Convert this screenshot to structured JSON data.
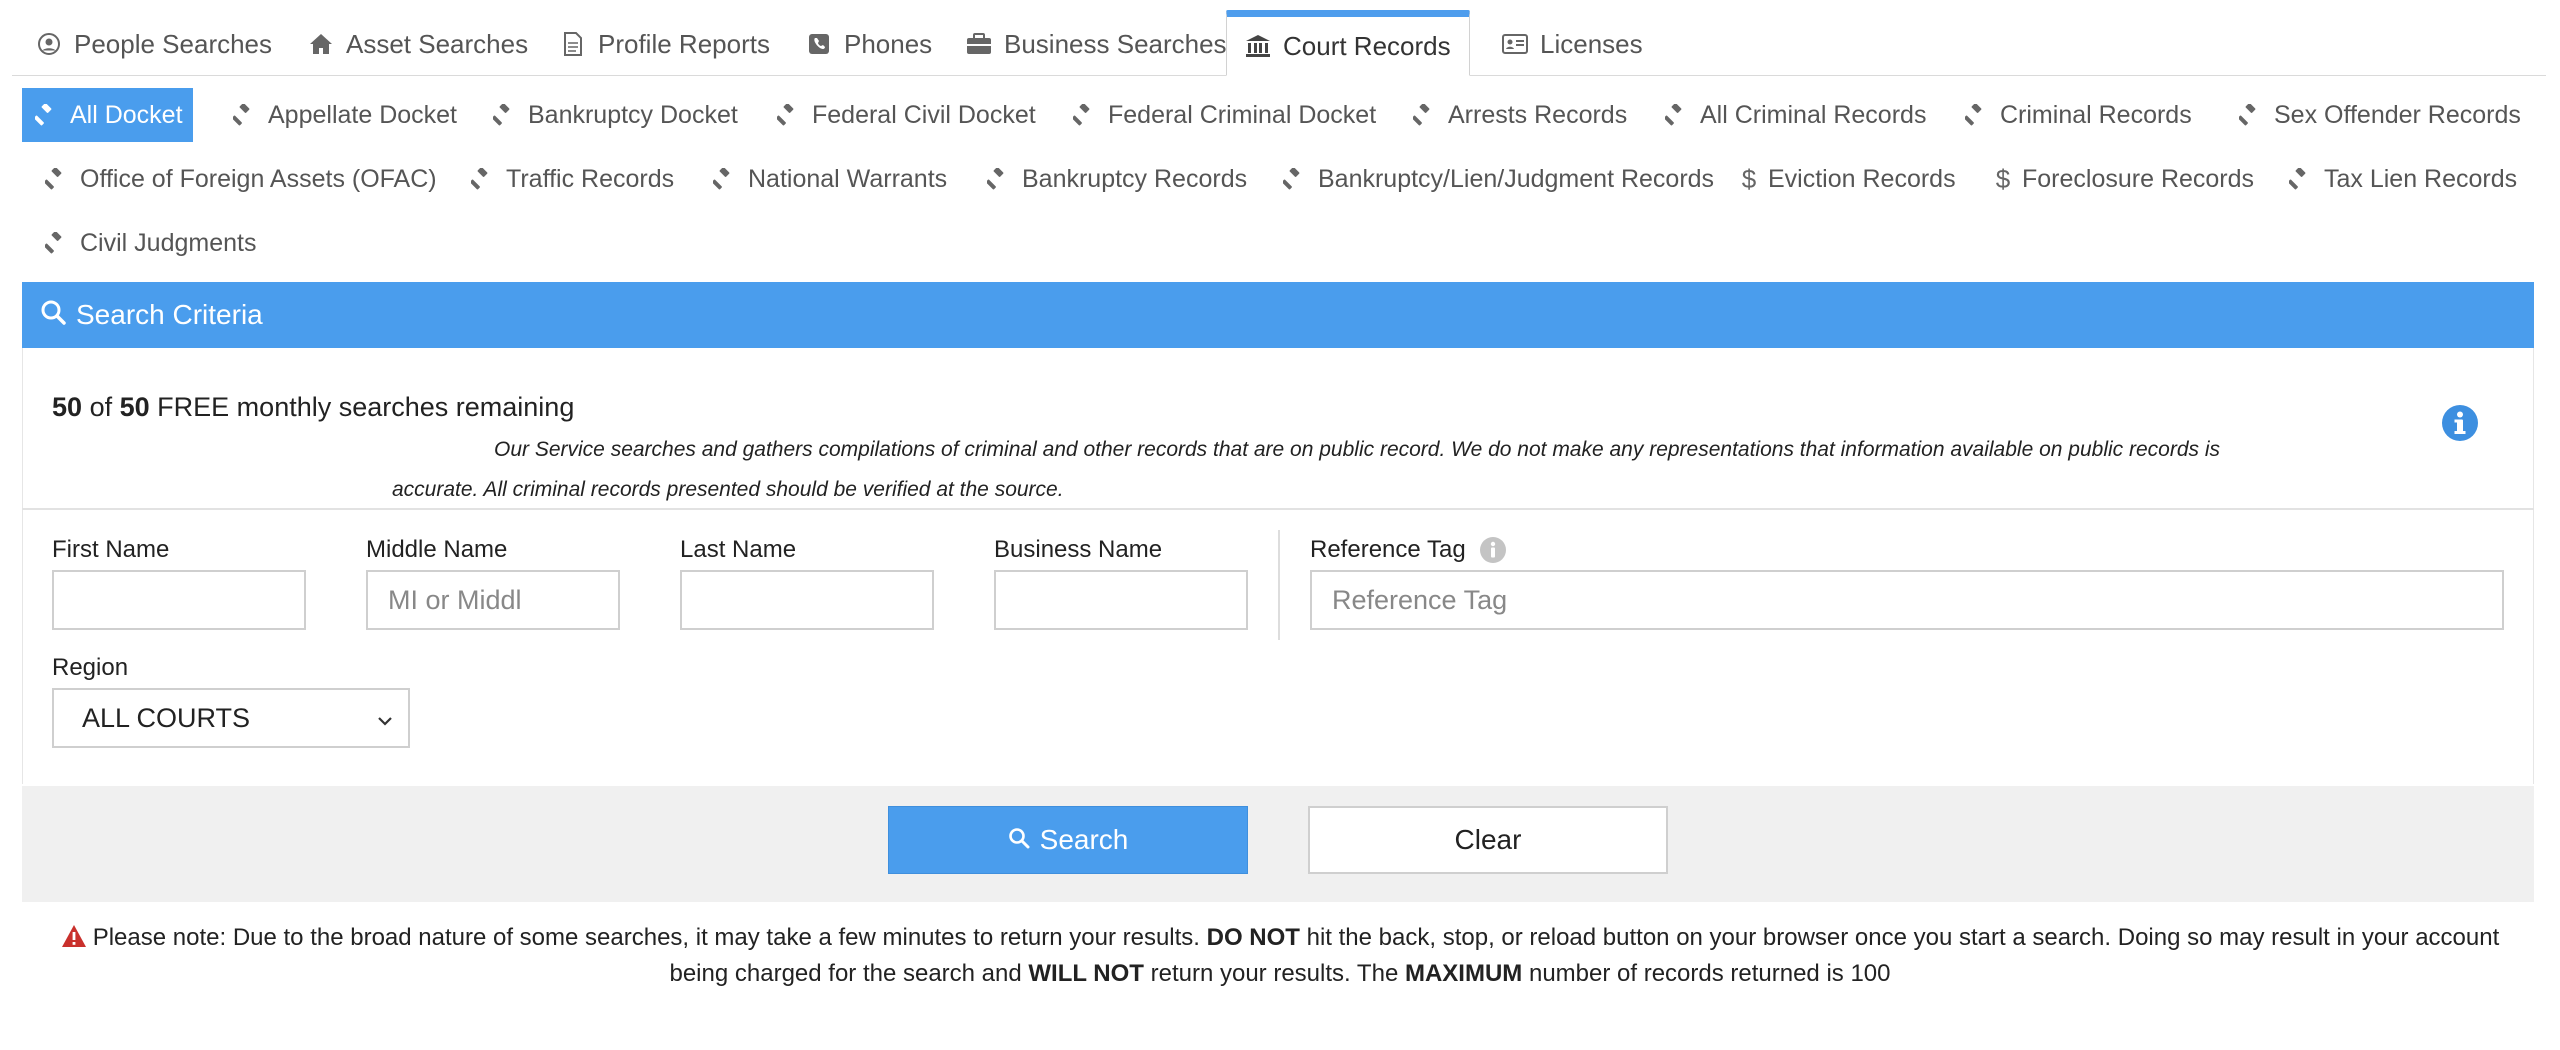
{
  "top_tabs": [
    {
      "label": "People Searches",
      "icon": "user-circle-icon"
    },
    {
      "label": "Asset Searches",
      "icon": "home-icon"
    },
    {
      "label": "Profile Reports",
      "icon": "document-icon"
    },
    {
      "label": "Phones",
      "icon": "phone-icon"
    },
    {
      "label": "Business Searches",
      "icon": "briefcase-icon"
    },
    {
      "label": "Court Records",
      "icon": "courthouse-icon",
      "active": true
    },
    {
      "label": "Licenses",
      "icon": "id-card-icon"
    }
  ],
  "sub_tabs": [
    {
      "label": "All Docket",
      "icon": "gavel-icon",
      "active": true
    },
    {
      "label": "Appellate Docket",
      "icon": "gavel-icon"
    },
    {
      "label": "Bankruptcy Docket",
      "icon": "gavel-icon"
    },
    {
      "label": "Federal Civil Docket",
      "icon": "gavel-icon"
    },
    {
      "label": "Federal Criminal Docket",
      "icon": "gavel-icon"
    },
    {
      "label": "Arrests Records",
      "icon": "gavel-icon"
    },
    {
      "label": "All Criminal Records",
      "icon": "gavel-icon"
    },
    {
      "label": "Criminal Records",
      "icon": "gavel-icon"
    },
    {
      "label": "Sex Offender Records",
      "icon": "gavel-icon"
    },
    {
      "label": "Office of Foreign Assets (OFAC)",
      "icon": "gavel-icon"
    },
    {
      "label": "Traffic Records",
      "icon": "gavel-icon"
    },
    {
      "label": "National Warrants",
      "icon": "gavel-icon"
    },
    {
      "label": "Bankruptcy Records",
      "icon": "gavel-icon"
    },
    {
      "label": "Bankruptcy/Lien/Judgment Records",
      "icon": "gavel-icon"
    },
    {
      "label": "Eviction Records",
      "icon": "dollar-icon"
    },
    {
      "label": "Foreclosure Records",
      "icon": "dollar-icon"
    },
    {
      "label": "Tax Lien Records",
      "icon": "gavel-icon"
    },
    {
      "label": "Civil Judgments",
      "icon": "gavel-icon"
    }
  ],
  "criteria": {
    "title": "Search Criteria",
    "remaining_used": "50",
    "remaining_of": "of",
    "remaining_total": "50",
    "remaining_suffix": "FREE monthly searches remaining",
    "disclaimer": "Our Service searches and gathers compilations of criminal and other records that are on public record. We do not make any representations that information available on public records is accurate. All criminal records presented should be verified at the source."
  },
  "form": {
    "first_name_label": "First Name",
    "first_name_value": "",
    "middle_name_label": "Middle Name",
    "middle_name_placeholder": "MI or Middl",
    "last_name_label": "Last Name",
    "last_name_value": "",
    "business_name_label": "Business Name",
    "business_name_value": "",
    "reference_tag_label": "Reference Tag",
    "reference_tag_placeholder": "Reference Tag",
    "region_label": "Region",
    "region_value": "ALL COURTS"
  },
  "buttons": {
    "search": "Search",
    "clear": "Clear"
  },
  "note": {
    "part1": "Please note: Due to the broad nature of some searches, it may take a few minutes to return your results.",
    "bold1": "DO NOT",
    "part2": "hit the back, stop, or reload button on your browser once you start a search. Doing so may result in your account being charged for the search and",
    "bold2": "WILL NOT",
    "part3": "return your results. The",
    "bold3": "MAXIMUM",
    "part4": "number of records returned is 100"
  },
  "colors": {
    "accent": "#4a9ded",
    "warning": "#c9302c"
  }
}
